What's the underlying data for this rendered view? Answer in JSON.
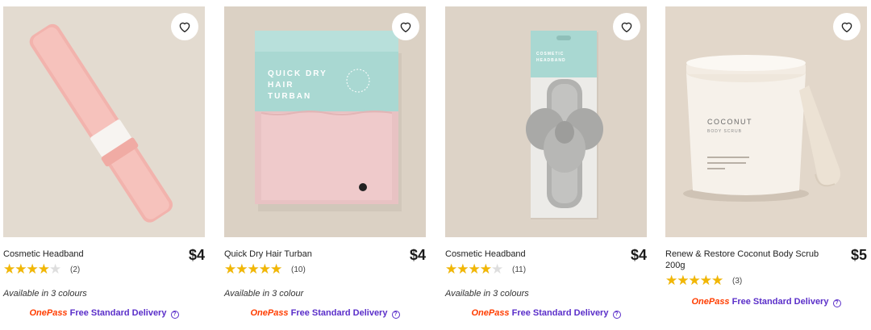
{
  "products": [
    {
      "title": "Cosmetic Headband",
      "price": "$4",
      "rating": 3.5,
      "stars_text": "★★★★★",
      "review_count": "(2)",
      "availability": "Available in 3 colours",
      "onepass_label": "OnePass",
      "delivery_label": "Free Standard Delivery",
      "image": "pink-headband"
    },
    {
      "title": "Quick Dry Hair Turban",
      "price": "$4",
      "rating": 4.5,
      "stars_text": "★★★★★",
      "review_count": "(10)",
      "availability": "Available in 3 colour",
      "onepass_label": "OnePass",
      "delivery_label": "Free Standard Delivery",
      "image": "hair-turban-box",
      "package_text": [
        "QUICK DRY",
        "HAIR",
        "TURBAN"
      ]
    },
    {
      "title": "Cosmetic Headband",
      "price": "$4",
      "rating": 3.5,
      "stars_text": "★★★★★",
      "review_count": "(11)",
      "availability": "Available in 3 colours",
      "onepass_label": "OnePass",
      "delivery_label": "Free Standard Delivery",
      "image": "grey-bow-headband",
      "package_text": [
        "COSMETIC",
        "HEADBAND"
      ]
    },
    {
      "title": "Renew & Restore Coconut Body Scrub 200g",
      "price": "$5",
      "rating": 5,
      "stars_text": "★★★★★",
      "review_count": "(3)",
      "availability": "",
      "onepass_label": "OnePass",
      "delivery_label": "Free Standard Delivery",
      "image": "coconut-scrub-tub",
      "package_text": [
        "COCONUT",
        "BODY SCRUB"
      ]
    }
  ],
  "icons": {
    "favourite": "heart-outline-icon",
    "info": "question-circle-icon"
  },
  "colors": {
    "star": "#f2b705",
    "star_empty": "#dedede",
    "onepass": "#ff3d00",
    "delivery": "#5a2ec9",
    "image_bg": "#ddd3c6"
  }
}
